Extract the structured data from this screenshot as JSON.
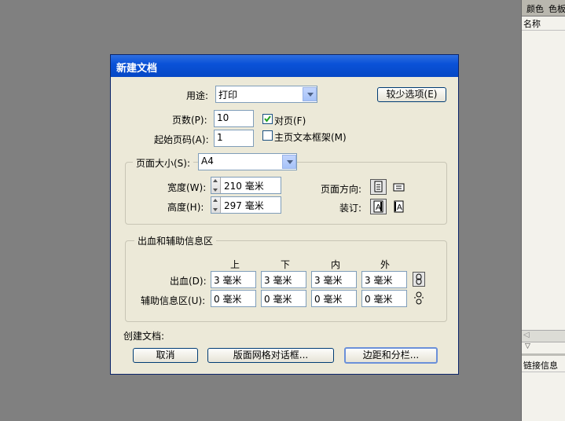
{
  "side_panel": {
    "tab_color": "颜色",
    "tab_swatches": "色板",
    "name_header": "名称",
    "links_header": "链接信息"
  },
  "dialog": {
    "title": "新建文档",
    "intent_label": "用途:",
    "intent_value": "打印",
    "fewer_options": "较少选项(E)",
    "pages_label": "页数(P):",
    "pages_value": "10",
    "facing_pages": "对页(F)",
    "facing_checked": true,
    "start_page_label": "起始页码(A):",
    "start_page_value": "1",
    "master_text_frame": "主页文本框架(M)",
    "master_checked": false,
    "page_size_label": "页面大小(S):",
    "page_size_value": "A4",
    "width_label": "宽度(W):",
    "width_value": "210 毫米",
    "height_label": "高度(H):",
    "height_value": "297 毫米",
    "orientation_label": "页面方向:",
    "binding_label": "装订:",
    "bleed_group": "出血和辅助信息区",
    "col_top": "上",
    "col_bottom": "下",
    "col_inside": "内",
    "col_outside": "外",
    "bleed_label": "出血(D):",
    "bleed_values": [
      "3 毫米",
      "3 毫米",
      "3 毫米",
      "3 毫米"
    ],
    "slug_label": "辅助信息区(U):",
    "slug_values": [
      "0 毫米",
      "0 毫米",
      "0 毫米",
      "0 毫米"
    ],
    "create_label": "创建文档:",
    "cancel": "取消",
    "layout_grid": "版面网格对话框...",
    "margins_columns": "边距和分栏..."
  }
}
